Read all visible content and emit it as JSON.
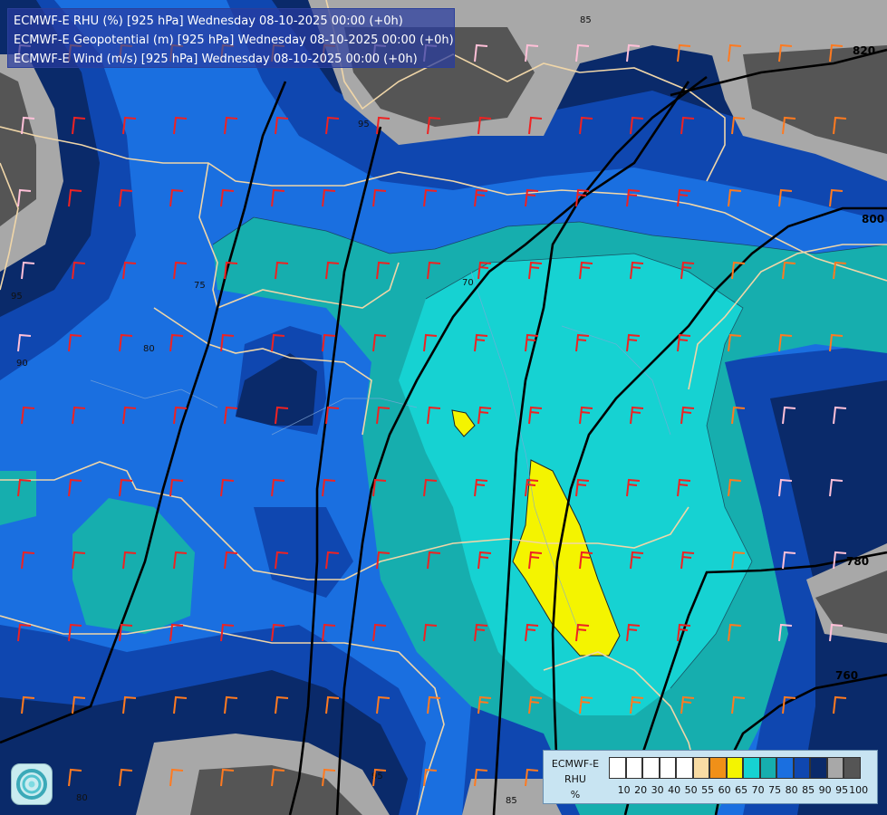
{
  "title": {
    "line1": "ECMWF-E RHU (%) [925 hPa] Wednesday 08-10-2025 00:00 (+0h)",
    "line2": "ECMWF-E Geopotential (m) [925 hPa] Wednesday 08-10-2025 00:00 (+0h)",
    "line3": "ECMWF-E Wind (m/s) [925 hPa] Wednesday 08-10-2025 00:00 (+0h)"
  },
  "contour_labels": {
    "geo_820": "820",
    "geo_800": "800",
    "geo_780": "780",
    "geo_760": "760",
    "rhu_95a": "95",
    "rhu_95b": "95",
    "rhu_95c": "95",
    "rhu_90": "90",
    "rhu_85": "85",
    "rhu_85b": "85",
    "rhu_80": "80",
    "rhu_80b": "80",
    "rhu_75": "75",
    "rhu_70": "70"
  },
  "legend": {
    "model": "ECMWF-E",
    "param": "RHU",
    "unit": "%",
    "colors": [
      "#ffffff",
      "#ffffff",
      "#ffffff",
      "#ffffff",
      "#ffffff",
      "#f8dca4",
      "#f09018",
      "#f4f400",
      "#16d2d2",
      "#16aeae",
      "#1a6fe0",
      "#0f47b0",
      "#0a2a6a",
      "#a8a8a8",
      "#555555"
    ],
    "ticks": [
      "10",
      "20",
      "30",
      "40",
      "50",
      "55",
      "60",
      "65",
      "70",
      "75",
      "80",
      "85",
      "90",
      "95",
      "100"
    ]
  },
  "palette": {
    "c65": "#f4f400",
    "c70": "#16d2d2",
    "c75": "#16aeae",
    "c80": "#1a6fe0",
    "c85": "#0f47b0",
    "c90": "#0a2a6a",
    "c95": "#a8a8a8",
    "c100": "#555555"
  }
}
